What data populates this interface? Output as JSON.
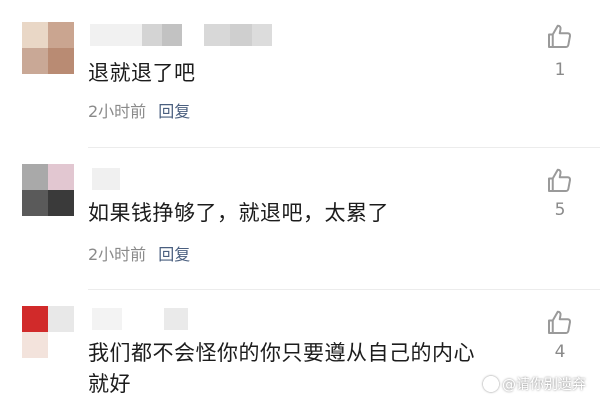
{
  "comments": [
    {
      "text": "退就退了吧",
      "time": "2小时前",
      "reply_label": "回复",
      "likes": "1"
    },
    {
      "text": "如果钱挣够了，就退吧，太累了",
      "time": "2小时前",
      "reply_label": "回复",
      "likes": "5"
    },
    {
      "text_line1": "我们都不会怪你的你只要遵从自己的内心",
      "text_line2": "就好",
      "likes": "4"
    }
  ],
  "watermark": {
    "text": "@请你别遗弃"
  },
  "icons": {
    "like": "thumbs-up-icon"
  },
  "colors": {
    "meta_gray": "#8a8a8a",
    "reply_blue": "#4a5f7f",
    "divider": "#ececec"
  }
}
